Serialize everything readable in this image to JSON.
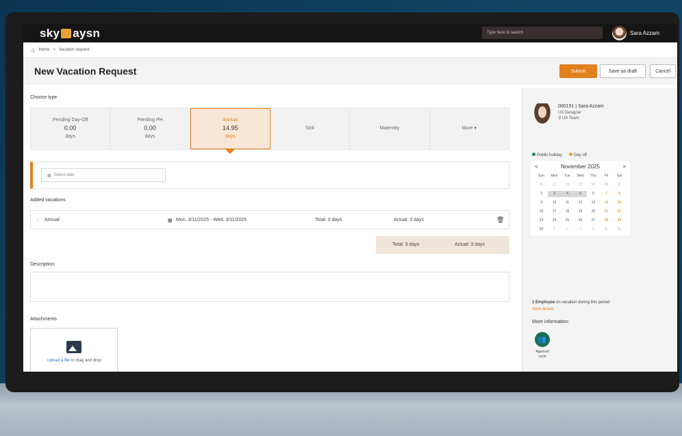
{
  "topbar": {
    "logo_left": "sky",
    "logo_right": "aysn",
    "search_placeholder": "Type here to search",
    "user_name": "Sara Azzam"
  },
  "breadcrumb": {
    "home": "Home",
    "separator": ">",
    "current": "Vacation request"
  },
  "header": {
    "title": "New Vacation Request",
    "submit": "Submit",
    "save_draft": "Save as draft",
    "cancel": "Cancel"
  },
  "choose_type": {
    "label": "Choose type",
    "cards": [
      {
        "name": "Pending Day-Off",
        "value": "0.00",
        "unit": "days"
      },
      {
        "name": "Pending PH",
        "value": "0.00",
        "unit": "days"
      },
      {
        "name": "Annual",
        "value": "14.95",
        "unit": "days"
      },
      {
        "name": "Sick",
        "value": "",
        "unit": ""
      },
      {
        "name": "Maternity",
        "value": "",
        "unit": ""
      },
      {
        "name": "More ▾",
        "value": "",
        "unit": ""
      }
    ],
    "active_index": 2
  },
  "date_picker": {
    "placeholder": "Select date"
  },
  "added_vacations": {
    "label": "Added vacations",
    "rows": [
      {
        "type": "Annual",
        "dates": "Mon. 3/11/2025 - Wed. 3/11/2025",
        "total": "Total: 3 days",
        "actual": "Actual: 3 days"
      }
    ],
    "summary_total": "Total: 3 days",
    "summary_actual": "Actual: 3 days"
  },
  "description": {
    "label": "Description:"
  },
  "attachments": {
    "label": "Attachments",
    "upload_link": "Upload a file",
    "upload_rest": "or drag and drop"
  },
  "profile": {
    "id": "000191",
    "name": "Sara Azzam",
    "role": "UX Designer",
    "team": "UX Team"
  },
  "legend": {
    "public_holiday": "Public holiday",
    "day_off": "Day off",
    "public_holiday_color": "#1d8a5a",
    "day_off_color": "#e2a23a"
  },
  "calendar": {
    "month": "November 2025",
    "prev": "<",
    "next": ">",
    "weekdays": [
      "Sun",
      "Mon",
      "Tue",
      "Wed",
      "Thu",
      "Fri",
      "Sat"
    ],
    "weeks": [
      [
        "26",
        "27",
        "28",
        "29",
        "30",
        "31",
        "1"
      ],
      [
        "2",
        "3",
        "4",
        "5",
        "6",
        "7",
        "8"
      ],
      [
        "9",
        "10",
        "11",
        "12",
        "13",
        "14",
        "15"
      ],
      [
        "16",
        "17",
        "18",
        "19",
        "20",
        "21",
        "22"
      ],
      [
        "23",
        "24",
        "25",
        "26",
        "27",
        "28",
        "29"
      ],
      [
        "30",
        "1",
        "2",
        "3",
        "4",
        "5",
        "6"
      ]
    ]
  },
  "vacation_info": {
    "count_bold": "1 Employee",
    "count_rest": "on vacation during this period",
    "view_details": "View details",
    "more_info": "More information:",
    "approval": "Approval cycle"
  },
  "colors": {
    "accent": "#e2801e",
    "topbar": "#151515",
    "approval": "#1d6e57"
  }
}
